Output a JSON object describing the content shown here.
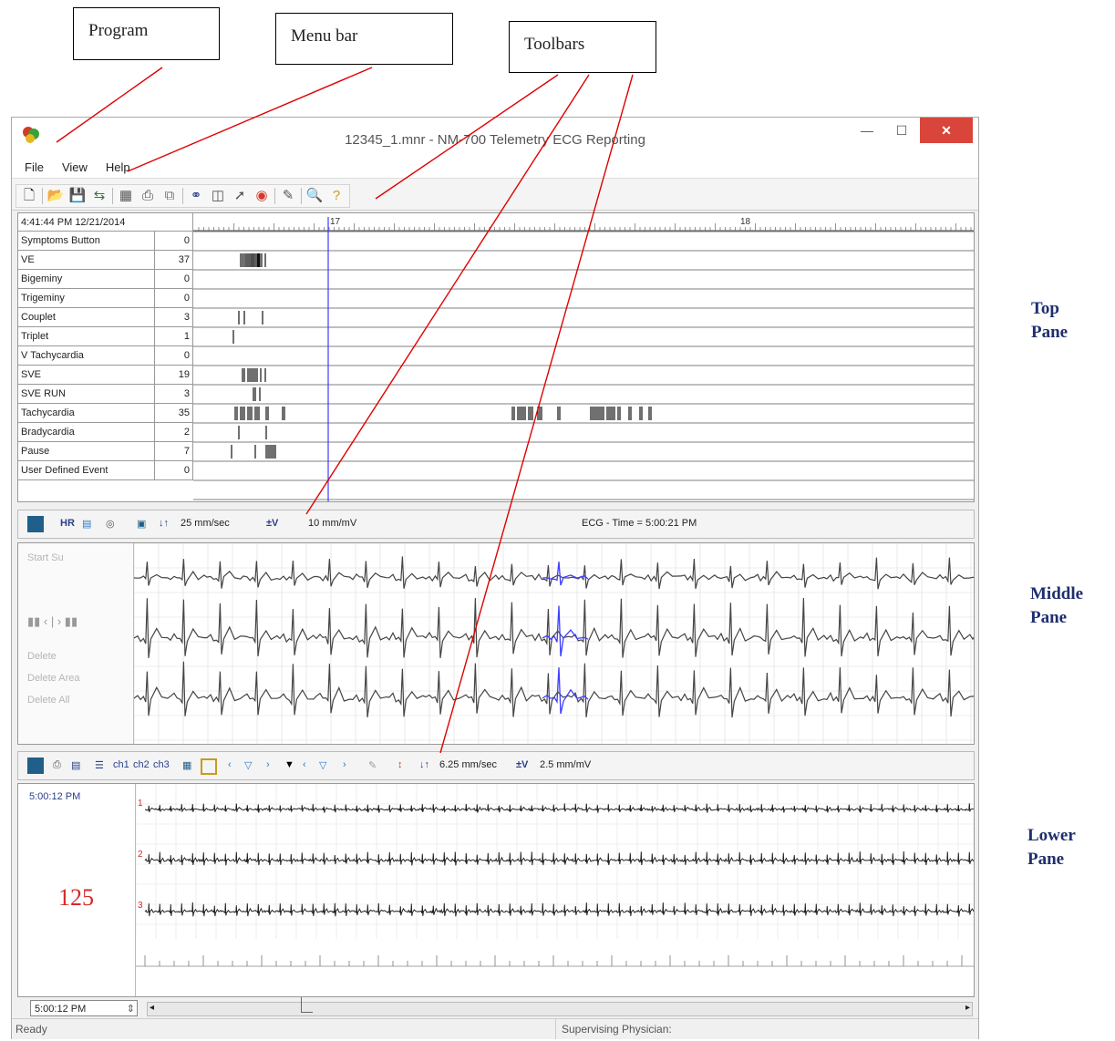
{
  "callouts": {
    "program": "Program",
    "menu_bar": "Menu bar",
    "toolbars": "Toolbars"
  },
  "side_labels": {
    "top": [
      "Top",
      "Pane"
    ],
    "middle": [
      "Middle",
      "Pane"
    ],
    "lower": [
      "Lower",
      "Pane"
    ]
  },
  "window": {
    "title": "12345_1.mnr - NM-700 Telemetry ECG Reporting",
    "minimize": "—",
    "maximize": "☐",
    "close": "✕"
  },
  "menu": [
    "File",
    "View",
    "Help"
  ],
  "top_pane": {
    "timestamp": "4:41:44 PM 12/21/2014",
    "events": [
      {
        "name": "Symptoms Button",
        "count": "0"
      },
      {
        "name": "VE",
        "count": "37"
      },
      {
        "name": "Bigeminy",
        "count": "0"
      },
      {
        "name": "Trigeminy",
        "count": "0"
      },
      {
        "name": "Couplet",
        "count": "3"
      },
      {
        "name": "Triplet",
        "count": "1"
      },
      {
        "name": "V Tachycardia",
        "count": "0"
      },
      {
        "name": "SVE",
        "count": "19"
      },
      {
        "name": "SVE RUN",
        "count": "3"
      },
      {
        "name": "Tachycardia",
        "count": "35"
      },
      {
        "name": "Bradycardia",
        "count": "2"
      },
      {
        "name": "Pause",
        "count": "7"
      },
      {
        "name": "User Defined Event",
        "count": "0"
      }
    ],
    "ruler_marks": [
      "17",
      "18"
    ]
  },
  "middle_pane": {
    "speed": "25 mm/sec",
    "gain": "10 mm/mV",
    "info": "ECG  -  Time = 5:00:21 PM",
    "controls": [
      "Start Su",
      "Delete",
      "Delete Area",
      "Delete All"
    ]
  },
  "lower_pane": {
    "time": "5:00:12 PM",
    "heart_rate": "125",
    "channels": [
      "ch1",
      "ch2",
      "ch3"
    ],
    "speed": "6.25 mm/sec",
    "gain": "2.5 mm/mV",
    "time_field": "5:00:12 PM",
    "row_markers": [
      "1",
      "2",
      "3"
    ]
  },
  "status": {
    "left": "Ready",
    "right": "Supervising Physician:"
  },
  "colors": {
    "callout_line": "#e00000",
    "cursor": "#3d3dff",
    "side_label": "#1f2f6e",
    "heart_rate": "#d42a2a",
    "close_button": "#d9453a"
  }
}
